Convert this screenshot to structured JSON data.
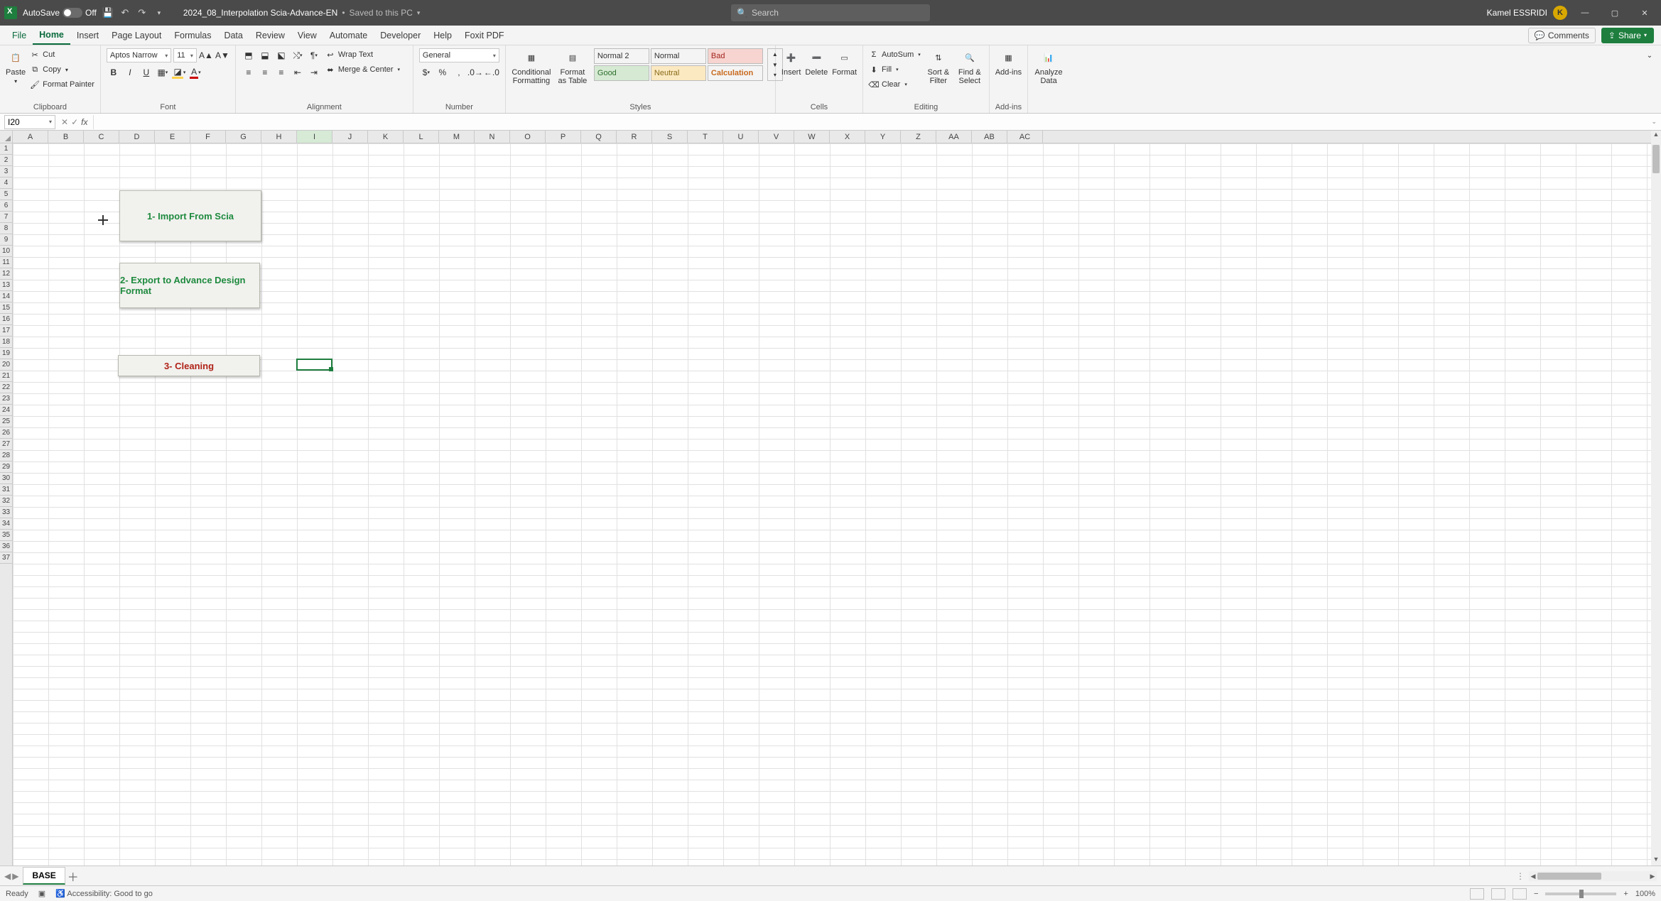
{
  "title": {
    "autosave_label": "AutoSave",
    "autosave_state": "Off",
    "filename": "2024_08_Interpolation Scia-Advance-EN",
    "location_tag": "Saved to this PC",
    "search_placeholder": "Search",
    "username": "Kamel ESSRIDI",
    "avatar_initial": "K"
  },
  "menu": {
    "tabs": [
      "File",
      "Home",
      "Insert",
      "Page Layout",
      "Formulas",
      "Data",
      "Review",
      "View",
      "Automate",
      "Developer",
      "Help",
      "Foxit PDF"
    ],
    "active": "Home",
    "comments": "Comments",
    "share": "Share"
  },
  "ribbon": {
    "clipboard": {
      "paste": "Paste",
      "cut": "Cut",
      "copy": "Copy",
      "format_painter": "Format Painter",
      "label": "Clipboard"
    },
    "font": {
      "name": "Aptos Narrow",
      "size": "11",
      "label": "Font"
    },
    "alignment": {
      "wrap": "Wrap Text",
      "merge": "Merge & Center",
      "label": "Alignment"
    },
    "number": {
      "format": "General",
      "label": "Number"
    },
    "styles": {
      "cond": "Conditional Formatting",
      "table": "Format as Table",
      "cells": [
        "Normal 2",
        "Normal",
        "Bad",
        "Good",
        "Neutral",
        "Calculation"
      ],
      "label": "Styles"
    },
    "cells_grp": {
      "insert": "Insert",
      "delete": "Delete",
      "format": "Format",
      "label": "Cells"
    },
    "editing": {
      "autosum": "AutoSum",
      "fill": "Fill",
      "clear": "Clear",
      "sort": "Sort & Filter",
      "find": "Find & Select",
      "label": "Editing"
    },
    "addins": {
      "addins": "Add-ins",
      "label": "Add-ins"
    },
    "analyze": {
      "analyze": "Analyze Data"
    }
  },
  "formula": {
    "namebox": "I20",
    "fx": "fx"
  },
  "columns": [
    "A",
    "B",
    "C",
    "D",
    "E",
    "F",
    "G",
    "H",
    "I",
    "J",
    "K",
    "L",
    "M",
    "N",
    "O",
    "P",
    "Q",
    "R",
    "S",
    "T",
    "U",
    "V",
    "W",
    "X",
    "Y",
    "Z",
    "AA",
    "AB",
    "AC"
  ],
  "row_count": 37,
  "shapes": {
    "b1": "1- Import From Scia",
    "b2": "2- Export to Advance Design Format",
    "b3": "3- Cleaning"
  },
  "sheet": {
    "active": "BASE"
  },
  "status": {
    "ready": "Ready",
    "access": "Accessibility: Good to go",
    "zoom": "100%"
  }
}
